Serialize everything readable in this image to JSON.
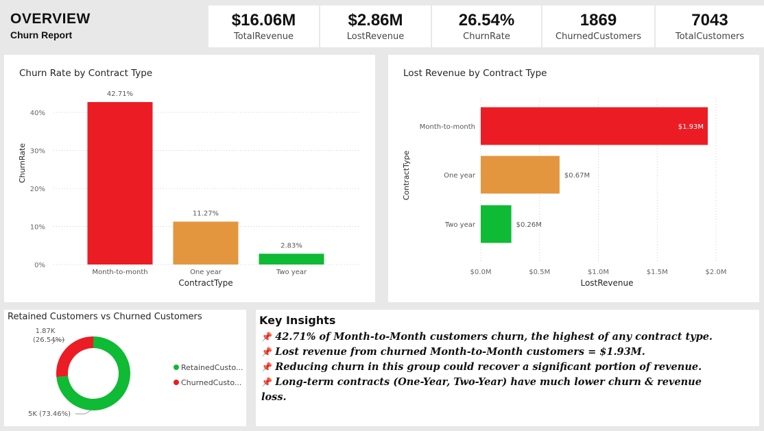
{
  "header": {
    "title": "OVERVIEW",
    "subtitle": "Churn Report"
  },
  "kpis": [
    {
      "value": "$16.06M",
      "label": "TotalRevenue"
    },
    {
      "value": "$2.86M",
      "label": "LostRevenue"
    },
    {
      "value": "26.54%",
      "label": "ChurnRate"
    },
    {
      "value": "1869",
      "label": "ChurnedCustomers"
    },
    {
      "value": "7043",
      "label": "TotalCustomers"
    }
  ],
  "colors": {
    "red": "#ec1c24",
    "orange": "#e3963e",
    "green": "#0fba34"
  },
  "chart_data": [
    {
      "type": "bar",
      "title": "Churn Rate by Contract Type",
      "xlabel": "ContractType",
      "ylabel": "ChurnRate",
      "categories": [
        "Month-to-month",
        "One year",
        "Two year"
      ],
      "values": [
        42.71,
        11.27,
        2.83
      ],
      "data_labels": [
        "42.71%",
        "11.27%",
        "2.83%"
      ],
      "ylim": [
        0,
        45
      ],
      "yticks": [
        0,
        10,
        20,
        30,
        40
      ],
      "ytick_labels": [
        "0%",
        "10%",
        "20%",
        "30%",
        "40%"
      ],
      "colors": [
        "#ec1c24",
        "#e3963e",
        "#0fba34"
      ],
      "grid": true
    },
    {
      "type": "bar",
      "orientation": "horizontal",
      "title": "Lost Revenue by Contract Type",
      "xlabel": "LostRevenue",
      "ylabel": "ContractType",
      "categories": [
        "Month-to-month",
        "One year",
        "Two year"
      ],
      "values": [
        1.93,
        0.67,
        0.26
      ],
      "data_labels": [
        "$1.93M",
        "$0.67M",
        "$0.26M"
      ],
      "xlim": [
        0,
        2.0
      ],
      "xticks": [
        0,
        0.5,
        1.0,
        1.5,
        2.0
      ],
      "xtick_labels": [
        "$0.0M",
        "$0.5M",
        "$1.0M",
        "$1.5M",
        "$2.0M"
      ],
      "colors": [
        "#ec1c24",
        "#e3963e",
        "#0fba34"
      ],
      "grid": true
    },
    {
      "type": "pie",
      "donut": true,
      "title": "Retained Customers vs Churned Customers",
      "slices": [
        {
          "label": "RetainedCusto...",
          "value": 5174,
          "data_label_1": "5K (73.46%)",
          "data_label_2": "",
          "color": "#0fba34"
        },
        {
          "label": "ChurnedCusto...",
          "value": 1869,
          "data_label_1": "1.87K",
          "data_label_2": "(26.54%)",
          "color": "#ec1c24"
        }
      ],
      "legend_position": "right"
    }
  ],
  "insights": {
    "title": "Key Insights",
    "pin_icon": "📌",
    "lines": [
      "42.71% of Month-to-Month customers churn, the highest of any contract type.",
      "Lost revenue from churned Month-to-Month customers = $1.93M.",
      "Reducing churn in this group could recover a significant portion of revenue.",
      "Long-term contracts (One-Year, Two-Year) have much lower churn & revenue",
      "loss."
    ]
  }
}
